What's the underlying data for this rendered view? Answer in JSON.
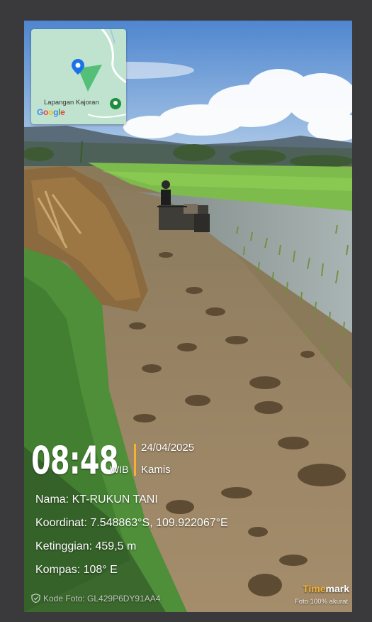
{
  "map": {
    "place_name": "Lapangan Kajoran",
    "logo_letters": [
      "G",
      "o",
      "o",
      "g",
      "l",
      "e"
    ],
    "pin_icon": "location-pin-icon",
    "place_icon": "place-marker-icon"
  },
  "stamp": {
    "time": "08:48",
    "timezone": "WIB",
    "date": "24/04/2025",
    "day": "Kamis",
    "name": "Nama: KT-RUKUN TANI",
    "coordinates": "Koordinat: 7.548863°S, 109.922067°E",
    "elevation": "Ketinggian: 459,5 m",
    "compass": "Kompas: 108° E",
    "photo_code": "Kode Foto: GL429P6DY91AA4"
  },
  "brand": {
    "name_part1": "Time",
    "name_part2": "mark",
    "tagline": "Foto 100% akurat"
  },
  "colors": {
    "accent": "#f2b233",
    "map_bg": "#bfe3cf",
    "pin": "#1a73e8"
  }
}
